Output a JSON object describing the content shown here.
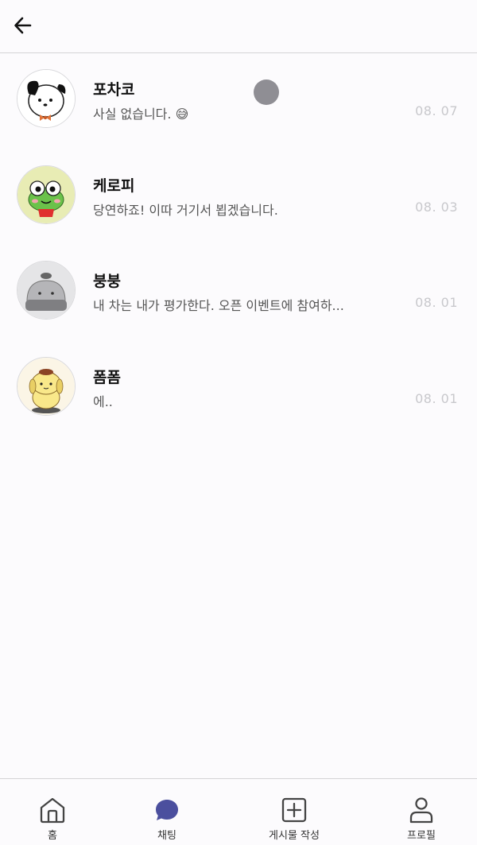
{
  "header": {
    "back_icon": "arrow-left-icon"
  },
  "chats": [
    {
      "name": "포차코",
      "message": "사실 없습니다. 😅",
      "date": "08. 07",
      "avatar": "pochacco-avatar"
    },
    {
      "name": "케로피",
      "message": "당연하죠! 이따 거기서 뵙겠습니다.",
      "date": "08. 03",
      "avatar": "keroppi-avatar"
    },
    {
      "name": "붕붕",
      "message": "내 차는 내가 평가한다. 오픈 이벤트에 참여하...",
      "date": "08. 01",
      "avatar": "bungbung-avatar"
    },
    {
      "name": "폼폼",
      "message": "에..",
      "date": "08. 01",
      "avatar": "pompom-avatar"
    }
  ],
  "tabs": [
    {
      "label": "홈",
      "icon": "home-icon",
      "active": false
    },
    {
      "label": "채팅",
      "icon": "chat-bubble-icon",
      "active": true
    },
    {
      "label": "게시물 작성",
      "icon": "plus-square-icon",
      "active": false
    },
    {
      "label": "프로필",
      "icon": "user-icon",
      "active": false
    }
  ],
  "colors": {
    "background": "#fcfbfd",
    "accent": "#4b4f9e",
    "date_text": "#c8c8cc",
    "divider": "#d4d4d6"
  }
}
